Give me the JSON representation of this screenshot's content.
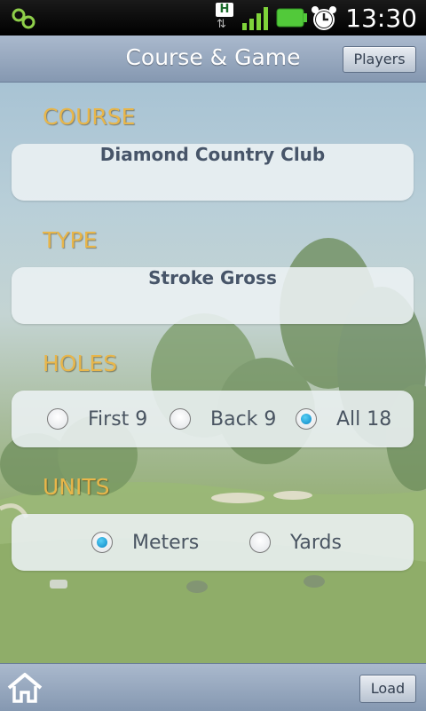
{
  "status_bar": {
    "time": "13:30",
    "network_badge": "H",
    "icons": [
      "app-notification-icon",
      "data-transfer-icon",
      "signal-icon",
      "battery-icon",
      "alarm-icon"
    ],
    "colors": {
      "signal": "#7fd33a",
      "battery": "#52c93a"
    }
  },
  "header": {
    "title": "Course & Game",
    "players_button": "Players"
  },
  "course": {
    "label": "COURSE",
    "value": "Diamond Country Club"
  },
  "type": {
    "label": "TYPE",
    "value": "Stroke Gross"
  },
  "holes": {
    "label": "HOLES",
    "options": [
      {
        "label": "First 9",
        "selected": false
      },
      {
        "label": "Back 9",
        "selected": false
      },
      {
        "label": "All 18",
        "selected": true
      }
    ]
  },
  "units": {
    "label": "UNITS",
    "options": [
      {
        "label": "Meters",
        "selected": true
      },
      {
        "label": "Yards",
        "selected": false
      }
    ]
  },
  "footer": {
    "home_icon": "home-icon",
    "load_button": "Load"
  },
  "colors": {
    "section_label": "#e8b64a",
    "radio_selected": "#0a86c5",
    "bar": "#8598b1"
  }
}
